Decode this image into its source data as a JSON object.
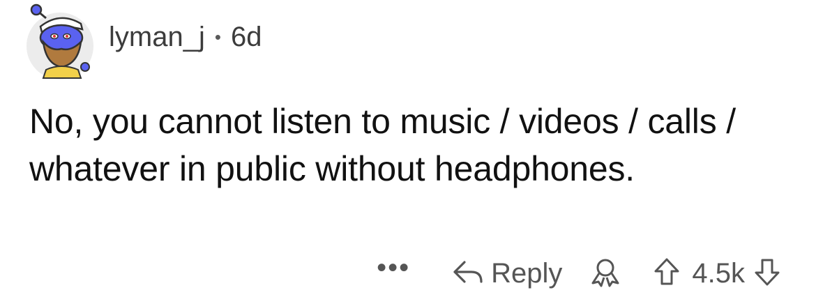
{
  "comment": {
    "username": "lyman_j",
    "separator": "•",
    "age": "6d",
    "body": "No, you cannot listen to music / videos / calls / whatever in public without headphones."
  },
  "actions": {
    "more_label": "•••",
    "reply_label": "Reply",
    "vote_count": "4.5k"
  },
  "icons": {
    "reply": "reply-arrow-icon",
    "award": "award-icon",
    "upvote": "upvote-arrow-icon",
    "downvote": "downvote-arrow-icon"
  },
  "colors": {
    "avatar_body": "#5a62f0",
    "avatar_beard": "#b07a3e",
    "avatar_bg": "#ececec",
    "text": "#111111",
    "muted": "#555555"
  }
}
